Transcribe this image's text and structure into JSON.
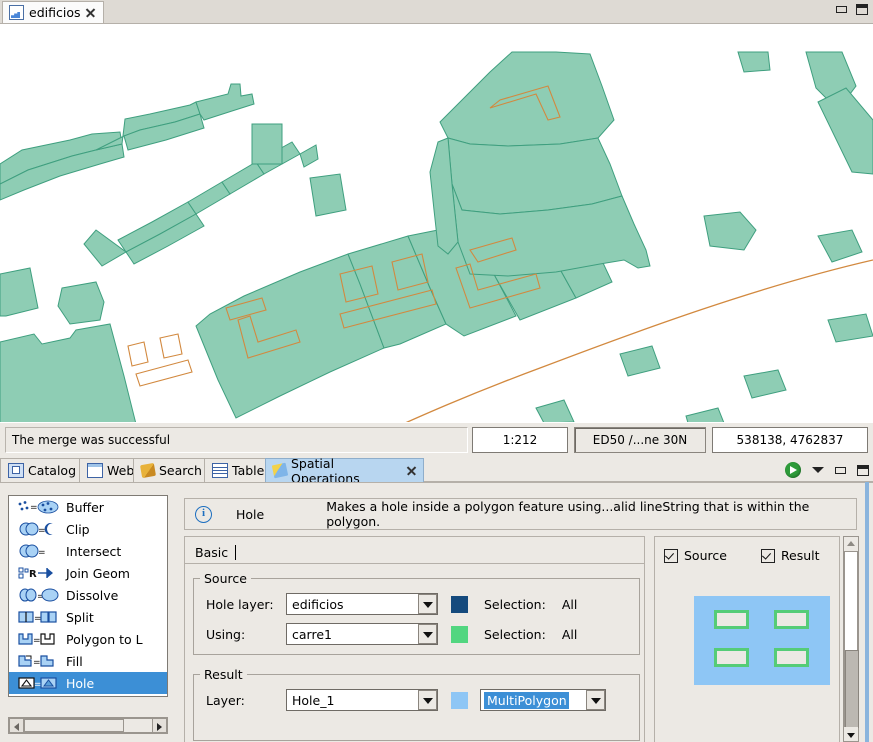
{
  "window": {
    "document_tab": {
      "label": "edificios",
      "icon": "map-layer-icon",
      "close": "×"
    },
    "minimize": "minimize",
    "maximize": "maximize"
  },
  "status_bar": {
    "message": "The merge was successful",
    "scale": "1:212",
    "crs": "ED50 /...ne 30N",
    "coordinates": "538138, 4762837"
  },
  "view_tabs": [
    {
      "label": "Catalog",
      "icon": "catalog-icon",
      "active": false
    },
    {
      "label": "Web",
      "icon": "web-icon",
      "active": false
    },
    {
      "label": "Search",
      "icon": "search-icon",
      "active": false
    },
    {
      "label": "Table",
      "icon": "table-icon",
      "active": false
    },
    {
      "label": "Spatial Operations",
      "icon": "spatial-operations-icon",
      "active": true
    }
  ],
  "panel_toolbar": {
    "run": "run-button",
    "menu": "chevron-down-icon",
    "minimize": "minimize",
    "maximize": "maximize"
  },
  "operations": [
    {
      "label": "Buffer",
      "selected": false
    },
    {
      "label": "Clip",
      "selected": false
    },
    {
      "label": "Intersect",
      "selected": false
    },
    {
      "label": "Join Geom",
      "selected": false
    },
    {
      "label": "Dissolve",
      "selected": false
    },
    {
      "label": "Split",
      "selected": false
    },
    {
      "label": "Polygon to L",
      "selected": false
    },
    {
      "label": "Fill",
      "selected": false
    },
    {
      "label": "Hole",
      "selected": true
    }
  ],
  "description": {
    "icon": "info-icon",
    "title": "Hole",
    "text": "Makes a hole inside a polygon feature using...alid lineString that is within the polygon."
  },
  "form": {
    "tab": "Basic",
    "source": {
      "legend": "Source",
      "hole_layer_label": "Hole layer:",
      "hole_layer_value": "edificios",
      "hole_layer_color": "#154a7d",
      "hole_layer_selection_label": "Selection:",
      "hole_layer_selection_value": "All",
      "using_label": "Using:",
      "using_value": "carre1",
      "using_color": "#52d680",
      "using_selection_label": "Selection:",
      "using_selection_value": "All"
    },
    "result": {
      "legend": "Result",
      "layer_label": "Layer:",
      "layer_value": "Hole_1",
      "layer_color": "#8ec6f5",
      "geometry_value": "MultiPolygon"
    }
  },
  "preview": {
    "source_label": "Source",
    "source_checked": true,
    "result_label": "Result",
    "result_checked": true,
    "canvas_color": "#8ec6f5",
    "hole_color": "#55cc77"
  },
  "map": {
    "polygon_fill": "#8ecdb4",
    "polygon_stroke": "#3f9f7f",
    "linestring_stroke": "#d2893f",
    "background": "#ffffff"
  }
}
